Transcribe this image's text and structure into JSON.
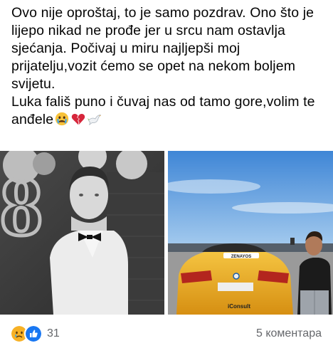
{
  "post": {
    "lines": [
      "Ovo nije oproštaj, to je samo pozdrav. Ono što je lijepo nikad ne prođe jer u srcu nam ostavlja sjećanja. Počivaj u miru najljepši moj prijatelju,vozit ćemo se opet na nekom boljem svijetu.",
      "Luka fališ puno i čuvaj nas od tamo gore,volim te anđele"
    ],
    "trailing_emojis": [
      "crying-face",
      "broken-heart",
      "dove"
    ]
  },
  "photos": [
    {
      "name": "memorial-photo-portrait",
      "description_icon": "photo"
    },
    {
      "name": "photo-with-car",
      "car_badge_text": "iConsult",
      "car_plate_text": "ZENAYOS"
    }
  ],
  "footer": {
    "reaction_icons": [
      "sad-reaction",
      "like-reaction"
    ],
    "reaction_count": "31",
    "comments_label": "5 коментара"
  },
  "colors": {
    "text": "#050505",
    "meta": "#65676b",
    "like_blue": "#1877f2",
    "sad_yellow": "#f7b125"
  }
}
